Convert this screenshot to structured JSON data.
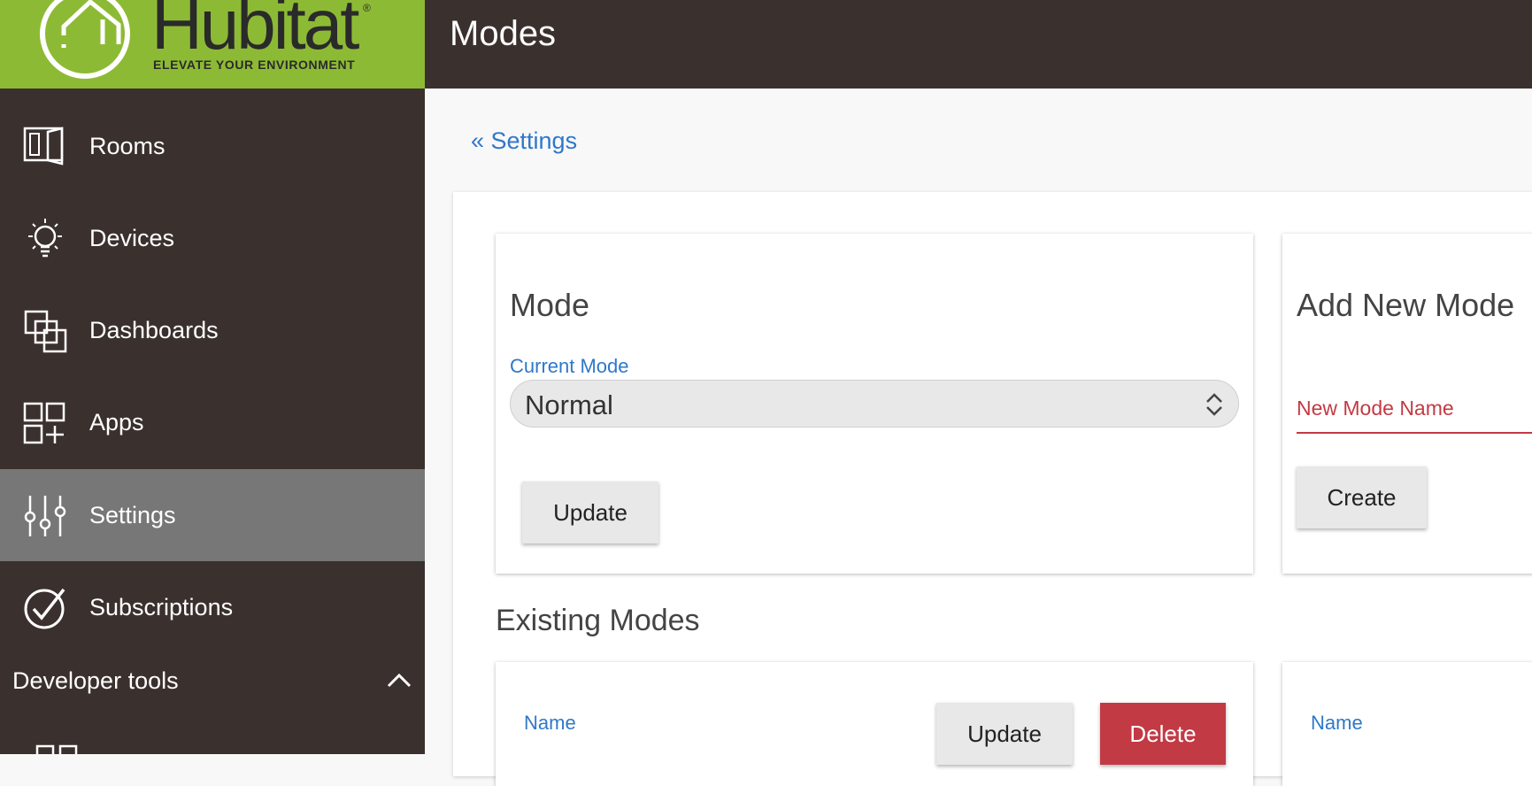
{
  "brand": {
    "name": "Hubitat",
    "tagline": "ELEVATE YOUR ENVIRONMENT",
    "reg": "®",
    "green": "#8dba35",
    "dark": "#3a302d"
  },
  "sidebar": {
    "items": [
      {
        "label": "Rooms",
        "icon": "rooms-icon"
      },
      {
        "label": "Devices",
        "icon": "lightbulb-icon"
      },
      {
        "label": "Dashboards",
        "icon": "dashboards-icon"
      },
      {
        "label": "Apps",
        "icon": "apps-icon"
      },
      {
        "label": "Settings",
        "icon": "sliders-icon",
        "active": true
      },
      {
        "label": "Subscriptions",
        "icon": "check-circle-icon"
      }
    ],
    "developer_tools": {
      "label": "Developer tools",
      "icon": "chevron-up-icon"
    }
  },
  "header": {
    "title": "Modes"
  },
  "breadcrumb": {
    "label": "« Settings"
  },
  "mode_card": {
    "title": "Mode",
    "current_mode_label": "Current Mode",
    "current_mode_value": "Normal",
    "update_label": "Update"
  },
  "add_card": {
    "title": "Add New Mode",
    "placeholder": "New Mode Name",
    "create_label": "Create"
  },
  "existing": {
    "title": "Existing Modes",
    "name_label": "Name",
    "update_label": "Update",
    "delete_label": "Delete"
  },
  "colors": {
    "accent": "#2f78c8",
    "danger": "#c23a44",
    "active_nav": "#777777"
  }
}
